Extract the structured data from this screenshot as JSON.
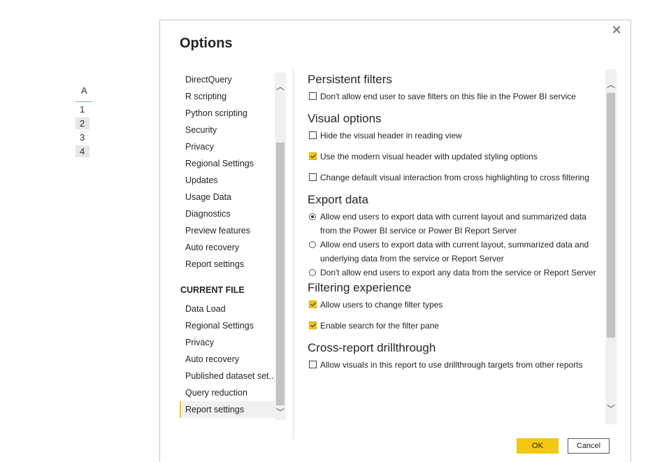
{
  "background_grid": {
    "column_header": "A",
    "rows": [
      "1",
      "2",
      "3",
      "4"
    ]
  },
  "dialog": {
    "title": "Options",
    "close_icon": "close-icon",
    "nav": {
      "global_items": [
        "DirectQuery",
        "R scripting",
        "Python scripting",
        "Security",
        "Privacy",
        "Regional Settings",
        "Updates",
        "Usage Data",
        "Diagnostics",
        "Preview features",
        "Auto recovery",
        "Report settings"
      ],
      "current_file_header": "CURRENT FILE",
      "current_file_items": [
        "Data Load",
        "Regional Settings",
        "Privacy",
        "Auto recovery",
        "Published dataset set...",
        "Query reduction",
        "Report settings"
      ],
      "selected": "Report settings"
    },
    "content": {
      "persistent_filters": {
        "heading": "Persistent filters",
        "option": {
          "label": "Don't allow end user to save filters on this file in the Power BI service",
          "checked": false
        }
      },
      "visual_options": {
        "heading": "Visual options",
        "options": [
          {
            "label": "Hide the visual header in reading view",
            "checked": false
          },
          {
            "label": "Use the modern visual header with updated styling options",
            "checked": true
          },
          {
            "label": "Change default visual interaction from cross highlighting to cross filtering",
            "checked": false
          }
        ]
      },
      "export_data": {
        "heading": "Export data",
        "options": [
          {
            "label": "Allow end users to export data with current layout and summarized data from the Power BI service or Power BI Report Server",
            "selected": true
          },
          {
            "label": "Allow end users to export data with current layout, summarized data and underlying data from the service or Report Server",
            "selected": false
          },
          {
            "label": "Don't allow end users to export any data from the service or Report Server",
            "selected": false
          }
        ]
      },
      "filtering_experience": {
        "heading": "Filtering experience",
        "options": [
          {
            "label": "Allow users to change filter types",
            "checked": true
          },
          {
            "label": "Enable search for the filter pane",
            "checked": true
          }
        ]
      },
      "cross_report": {
        "heading": "Cross-report drillthrough",
        "option": {
          "label": "Allow visuals in this report to use drillthrough targets from other reports",
          "checked": false
        }
      }
    },
    "buttons": {
      "ok": "OK",
      "cancel": "Cancel"
    },
    "colors": {
      "accent": "#f2c811",
      "scroll_track": "#f0f0f0",
      "scroll_thumb": "#c2c2c2"
    }
  }
}
